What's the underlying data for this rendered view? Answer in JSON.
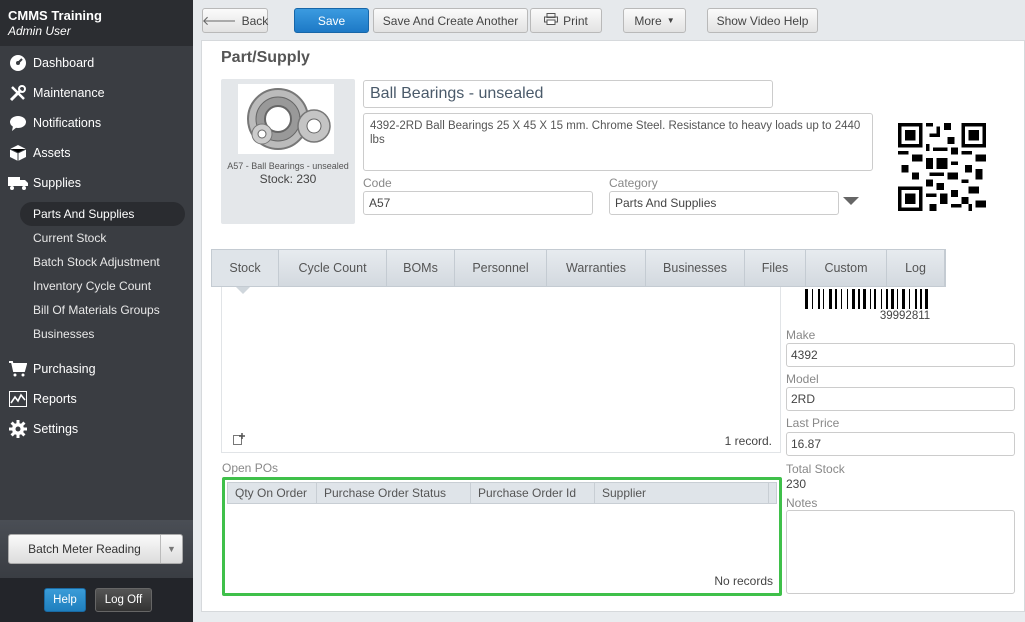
{
  "app": {
    "title": "CMMS Training",
    "user": "Admin User"
  },
  "nav": [
    {
      "label": "Dashboard",
      "icon": "dashboard-icon"
    },
    {
      "label": "Maintenance",
      "icon": "tools-icon"
    },
    {
      "label": "Notifications",
      "icon": "chat-bubble-icon"
    },
    {
      "label": "Assets",
      "icon": "box-icon"
    },
    {
      "label": "Supplies",
      "icon": "truck-icon"
    }
  ],
  "supplies_sub": [
    "Parts And Supplies",
    "Current Stock",
    "Batch Stock Adjustment",
    "Inventory Cycle Count",
    "Bill Of Materials Groups",
    "Businesses"
  ],
  "nav_bottom": [
    {
      "label": "Purchasing",
      "icon": "cart-icon"
    },
    {
      "label": "Reports",
      "icon": "chart-icon"
    },
    {
      "label": "Settings",
      "icon": "gear-icon"
    }
  ],
  "sidebar_footer": {
    "batch_meter": "Batch Meter Reading",
    "help": "Help",
    "logoff": "Log Off"
  },
  "toolbar": {
    "back": "Back",
    "save": "Save",
    "save_create": "Save And Create Another",
    "print": "Print",
    "more": "More",
    "video_help": "Show Video Help"
  },
  "page": {
    "title": "Part/Supply"
  },
  "part": {
    "image_caption": "A57 - Ball Bearings - unsealed",
    "stock_caption": "Stock: 230",
    "name": "Ball Bearings - unsealed",
    "description": "4392-2RD Ball Bearings 25 X 45 X 15 mm. Chrome Steel. Resistance to heavy loads up to 2440 lbs",
    "code_label": "Code",
    "code": "A57",
    "category_label": "Category",
    "category": "Parts And Supplies"
  },
  "tabs": [
    "Stock",
    "Cycle Count",
    "BOMs",
    "Personnel",
    "Warranties",
    "Businesses",
    "Files",
    "Custom",
    "Log"
  ],
  "active_tab": "Stock",
  "stock": {
    "record_count": "1 record."
  },
  "open_pos": {
    "label": "Open POs",
    "columns": [
      "Qty On Order",
      "Purchase Order Status",
      "Purchase Order Id",
      "Supplier"
    ],
    "empty": "No records"
  },
  "details": {
    "barcode": "39992811",
    "make_label": "Make",
    "make": "4392",
    "model_label": "Model",
    "model": "2RD",
    "last_price_label": "Last Price",
    "last_price": "16.87",
    "total_stock_label": "Total Stock",
    "total_stock": "230",
    "notes_label": "Notes"
  },
  "colors": {
    "accent": "#1d79c6",
    "highlight": "#3fc04a",
    "sidebar": "#3a3d42"
  }
}
